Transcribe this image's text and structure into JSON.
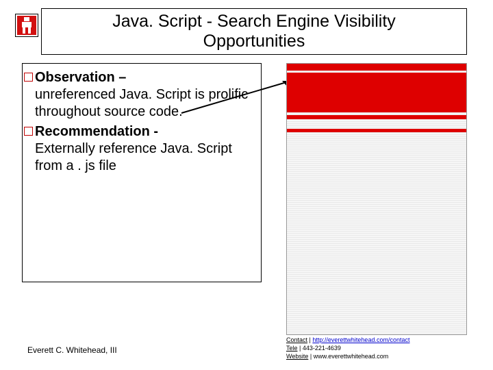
{
  "title_line1": "Java. Script - Search Engine Visibility",
  "title_line2": "Opportunities",
  "bullets": [
    {
      "head": "Observation –",
      "body": "unreferenced Java. Script is prolific throughout source code."
    },
    {
      "head": "Recommendation -",
      "body": "Externally reference Java. Script from a . js file"
    }
  ],
  "author": "Everett C. Whitehead, III",
  "contact": {
    "label_contact": "Contact",
    "url": "http://everettwhitehead.com/contact",
    "label_tele": "Tele",
    "phone": "443-221-4639",
    "label_website": "Website",
    "site": "www.everettwhitehead.com"
  }
}
